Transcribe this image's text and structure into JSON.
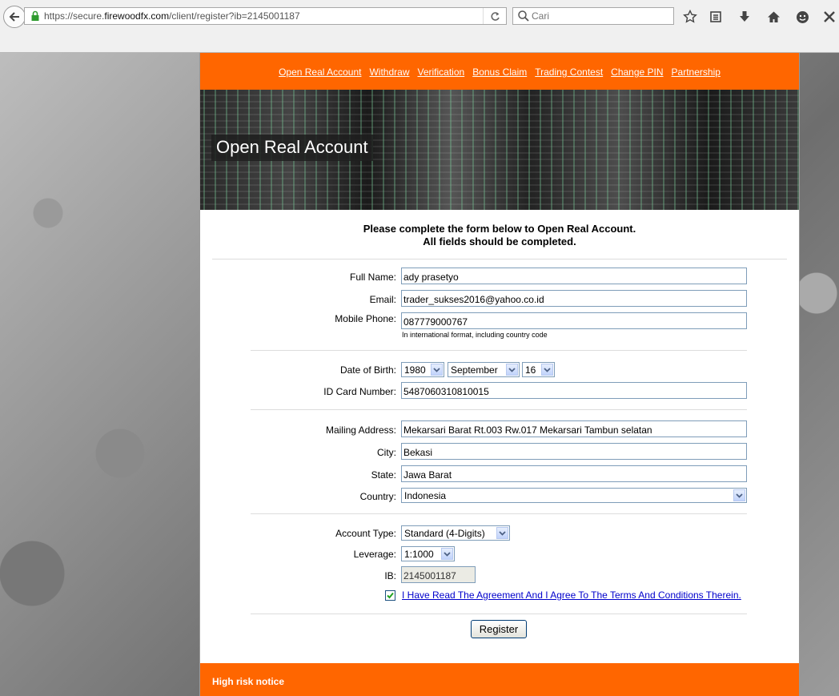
{
  "browser": {
    "url_prefix": "https://secure.",
    "url_domain": "firewoodfx.com",
    "url_path": "/client/register?ib=2145001187",
    "search_placeholder": "Cari"
  },
  "nav": {
    "items": [
      "Open Real Account",
      "Withdraw",
      "Verification",
      "Bonus Claim",
      "Trading Contest",
      "Change PIN",
      "Partnership"
    ]
  },
  "banner": {
    "title": "Open Real Account"
  },
  "intro": {
    "line1": "Please complete the form below to Open Real Account.",
    "line2": "All fields should be completed."
  },
  "form": {
    "full_name": {
      "label": "Full Name:",
      "value": "ady prasetyo"
    },
    "email": {
      "label": "Email:",
      "value": "trader_sukses2016@yahoo.co.id"
    },
    "mobile": {
      "label": "Mobile Phone:",
      "value": "087779000767",
      "hint": "In international format, including country code"
    },
    "dob": {
      "label": "Date of Birth:",
      "year": "1980",
      "month": "September",
      "day": "16"
    },
    "id_card": {
      "label": "ID Card Number:",
      "value": "5487060310810015"
    },
    "address": {
      "label": "Mailing Address:",
      "value": "Mekarsari Barat Rt.003 Rw.017 Mekarsari Tambun selatan"
    },
    "city": {
      "label": "City:",
      "value": "Bekasi"
    },
    "state": {
      "label": "State:",
      "value": "Jawa Barat"
    },
    "country": {
      "label": "Country:",
      "value": "Indonesia"
    },
    "account_type": {
      "label": "Account Type:",
      "value": "Standard (4-Digits)"
    },
    "leverage": {
      "label": "Leverage:",
      "value": "1:1000"
    },
    "ib": {
      "label": "IB:",
      "value": "2145001187"
    },
    "agreement": "I Have Read The Agreement And I Agree To The Terms And Conditions Therein.",
    "register_label": "Register"
  },
  "footer": {
    "notice": "High risk notice"
  },
  "colors": {
    "brand_orange": "#ff6600",
    "link_blue": "#0000cc",
    "field_border": "#7f9db9"
  }
}
